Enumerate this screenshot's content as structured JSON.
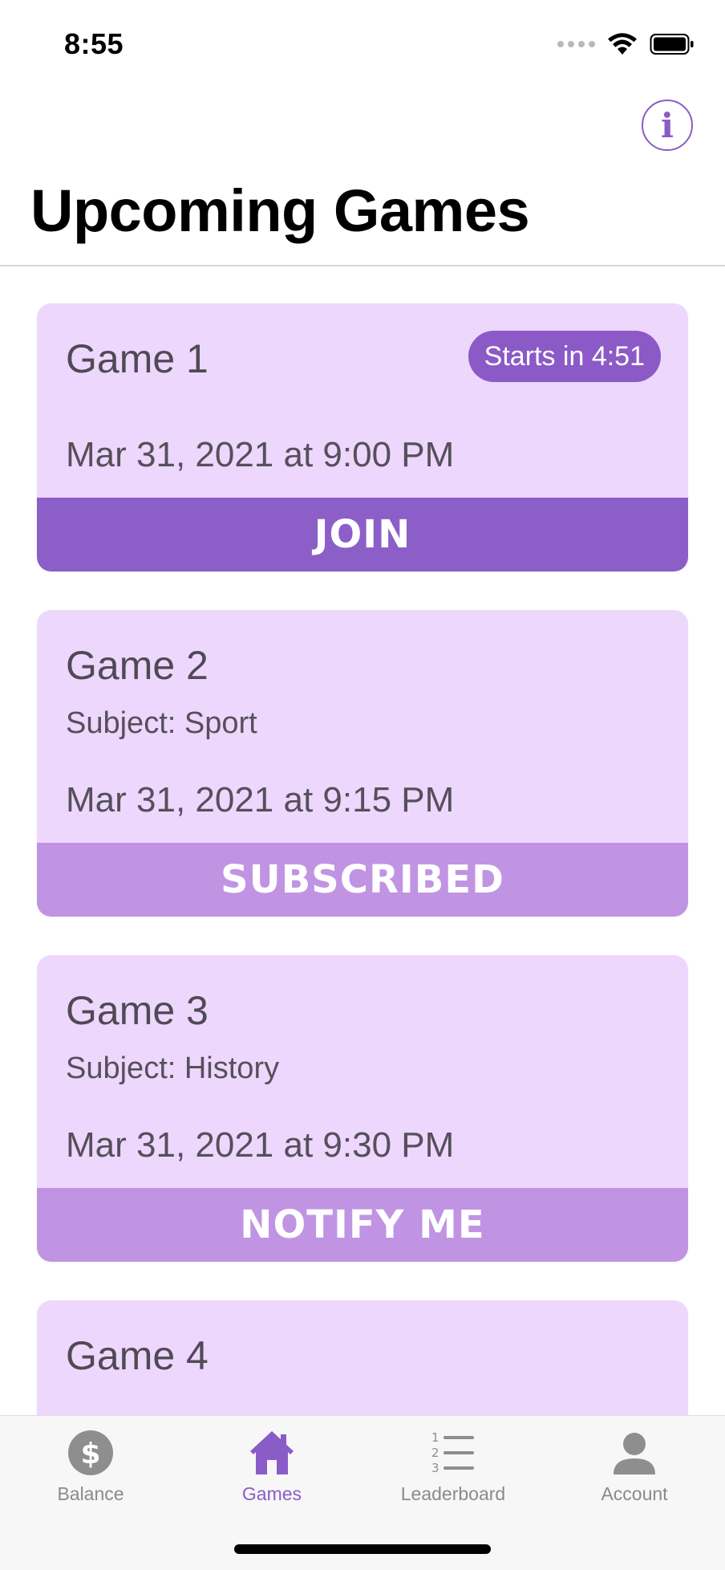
{
  "status_bar": {
    "time": "8:55"
  },
  "header": {
    "title": "Upcoming Games",
    "info_icon": "info-icon",
    "info_glyph": "i"
  },
  "games": [
    {
      "title": "Game 1",
      "badge": "Starts in 4:51",
      "date": "Mar 31, 2021 at 9:00 PM",
      "action": "JOIN"
    },
    {
      "title": "Game 2",
      "subject": "Subject: Sport",
      "date": "Mar 31, 2021 at 9:15 PM",
      "action": "SUBSCRIBED"
    },
    {
      "title": "Game 3",
      "subject": "Subject: History",
      "date": "Mar 31, 2021 at 9:30 PM",
      "action": "NOTIFY ME"
    },
    {
      "title": "Game 4"
    }
  ],
  "tab_bar": {
    "items": [
      {
        "label": "Balance",
        "icon": "dollar-icon"
      },
      {
        "label": "Games",
        "icon": "home-icon",
        "active": true
      },
      {
        "label": "Leaderboard",
        "icon": "list-icon"
      },
      {
        "label": "Account",
        "icon": "person-icon"
      }
    ]
  },
  "colors": {
    "accent": "#8a5cc7",
    "card_background": "#eed7fc",
    "primary_action": "#8b5ec8",
    "secondary_action": "#c094e3",
    "inactive_tab": "#8a8a8a"
  }
}
